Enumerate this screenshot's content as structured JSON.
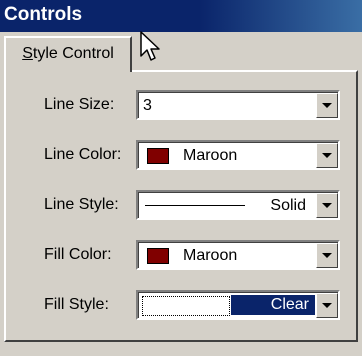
{
  "window": {
    "title": "Controls"
  },
  "tabs": [
    {
      "label_prefix": "S",
      "label_rest": "tyle Control"
    }
  ],
  "form": {
    "line_size": {
      "label": "Line Size:",
      "value": "3"
    },
    "line_color": {
      "label": "Line Color:",
      "value": "Maroon",
      "swatch": "#800000"
    },
    "line_style": {
      "label": "Line Style:",
      "value": "Solid"
    },
    "fill_color": {
      "label": "Fill Color:",
      "value": "Maroon",
      "swatch": "#800000"
    },
    "fill_style": {
      "label": "Fill Style:",
      "value": "Clear"
    }
  },
  "colors": {
    "title_bar": "#0a246a",
    "highlight": "#0a246a",
    "face": "#d4d0c8",
    "maroon": "#800000"
  },
  "icons": {
    "cursor": "mouse-pointer-icon",
    "dropdown": "chevron-down-icon"
  }
}
